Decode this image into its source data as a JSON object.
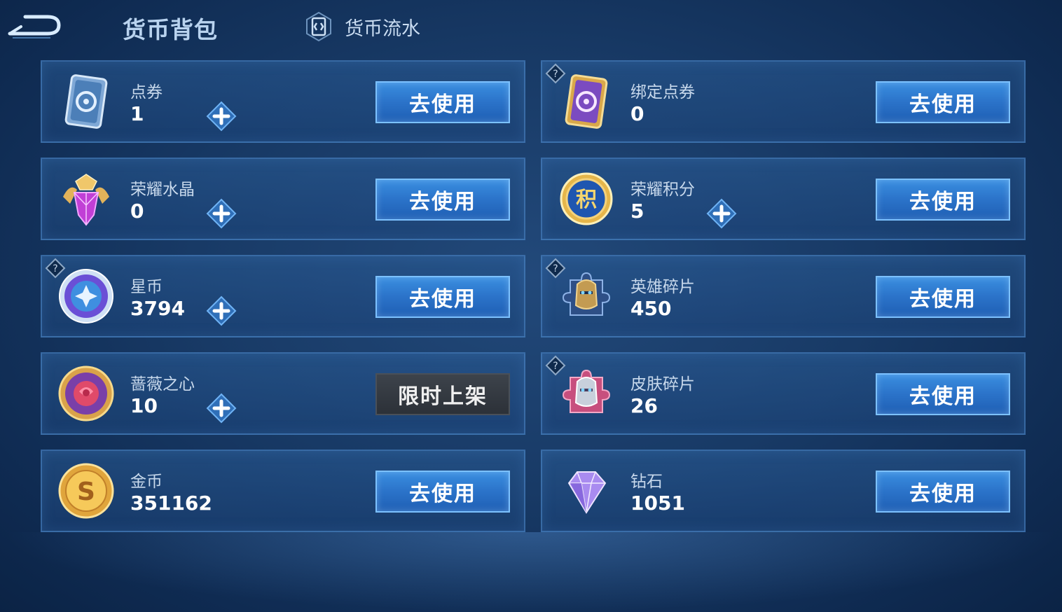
{
  "header": {
    "title": "货币背包",
    "history_label": "货币流水"
  },
  "currencies": [
    {
      "name": "点券",
      "amount": "1",
      "button": "去使用"
    },
    {
      "name": "绑定点券",
      "amount": "0",
      "button": "去使用"
    },
    {
      "name": "荣耀水晶",
      "amount": "0",
      "button": "去使用"
    },
    {
      "name": "荣耀积分",
      "amount": "5",
      "button": "去使用"
    },
    {
      "name": "星币",
      "amount": "3794",
      "button": "去使用"
    },
    {
      "name": "英雄碎片",
      "amount": "450",
      "button": "去使用"
    },
    {
      "name": "蔷薇之心",
      "amount": "10",
      "button": "限时上架"
    },
    {
      "name": "皮肤碎片",
      "amount": "26",
      "button": "去使用"
    },
    {
      "name": "金币",
      "amount": "351162",
      "button": "去使用"
    },
    {
      "name": "钻石",
      "amount": "1051",
      "button": "去使用"
    }
  ],
  "icons": {
    "ticket": "voucher-icon",
    "bound_ticket": "bound-voucher-icon",
    "crystal": "honor-crystal-icon",
    "points": "honor-points-icon",
    "star_coin": "star-coin-icon",
    "hero_fragment": "hero-fragment-icon",
    "rose": "rose-heart-icon",
    "skin_fragment": "skin-fragment-icon",
    "gold": "gold-coin-icon",
    "diamond": "diamond-icon",
    "plus": "plus-icon",
    "help": "help-icon"
  },
  "colors": {
    "accent_button": "#2b73c9",
    "limited_button": "#2f343b",
    "title": "#b9d3ef"
  }
}
